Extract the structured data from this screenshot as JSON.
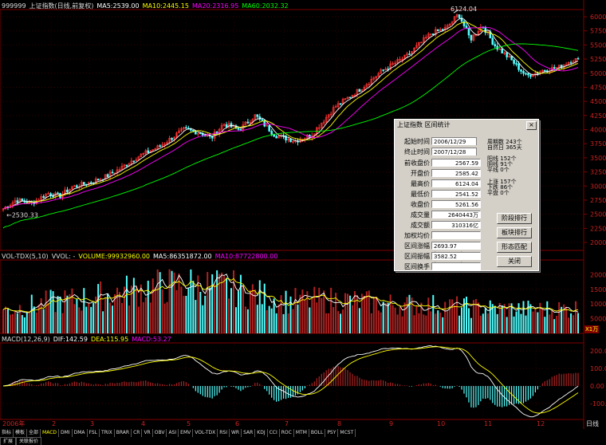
{
  "main_header": {
    "code": "999999",
    "name": "上证指数(日线,前复权)",
    "ma5_label": "MA5:",
    "ma5_value": "2539.00",
    "ma10_label": "MA10:",
    "ma10_value": "2445.15",
    "ma20_label": "MA20:",
    "ma20_value": "2316.95",
    "ma60_label": "MA60:",
    "ma60_value": "2032.32"
  },
  "vol_header": {
    "name": "VOL-TDX(5,10)",
    "vvol": "VVOL: -",
    "volume_label": "VOLUME:",
    "volume_value": "99932960.00",
    "ma5_label": "MA5:",
    "ma5_value": "86351872.00",
    "ma10_label": "MA10:",
    "ma10_value": "87722800.00"
  },
  "macd_header": {
    "name": "MACD(12,26,9)",
    "dif_label": "DIF:",
    "dif_value": "142.59",
    "dea_label": "DEA:",
    "dea_value": "115.95",
    "macd_label": "MACD:",
    "macd_value": "53.27"
  },
  "price_axis": [
    "6000",
    "5750",
    "5500",
    "5250",
    "5000",
    "4750",
    "4500",
    "4250",
    "4000",
    "3750",
    "3500",
    "3250",
    "3000",
    "2750",
    "2500",
    "2250",
    "2000"
  ],
  "vol_axis": [
    "20000",
    "15000",
    "10000",
    "5000"
  ],
  "vol_unit": "X1万",
  "macd_axis": [
    "200.0",
    "100.0",
    "0.00",
    "-100.0"
  ],
  "time_axis": [
    "2006年",
    "2",
    "3",
    "4",
    "5",
    "6",
    "7",
    "8",
    "9",
    "10",
    "11",
    "12"
  ],
  "period_label": "日线",
  "annotations": {
    "high": "6124.04",
    "low": "2530.33"
  },
  "colors": {
    "up": "#ff3232",
    "down": "#54ffff",
    "ma5": "#ffffff",
    "ma10": "#ffff00",
    "ma20": "#ff00ff",
    "ma60": "#00ff00"
  },
  "chart_data": [
    {
      "type": "line",
      "title": "上证指数(日线,前复权)",
      "x": [
        "2006年",
        "2",
        "3",
        "4",
        "5",
        "6",
        "7",
        "8",
        "9",
        "10",
        "11",
        "12"
      ],
      "series": [
        {
          "name": "MA5",
          "values": [
            2560,
            2700,
            2850,
            3050,
            3700,
            3950,
            3800,
            4400,
            5000,
            5600,
            5200,
            4950
          ]
        },
        {
          "name": "MA60",
          "values": [
            2150,
            2350,
            2550,
            2700,
            3000,
            3350,
            3600,
            3900,
            4350,
            4850,
            5300,
            5350
          ]
        }
      ],
      "ylim": [
        1900,
        6200
      ]
    },
    {
      "type": "bar",
      "title": "VOL-TDX(5,10)",
      "categories": [
        "2006年",
        "2",
        "3",
        "4",
        "5",
        "6",
        "7",
        "8",
        "9",
        "10",
        "11",
        "12"
      ],
      "values": [
        9500,
        11000,
        12500,
        16000,
        17000,
        16500,
        11500,
        12000,
        10500,
        10000,
        9000,
        9000
      ],
      "ylim": [
        0,
        22000
      ]
    },
    {
      "type": "line",
      "title": "MACD(12,26,9)",
      "x": [
        "2006年",
        "2",
        "3",
        "4",
        "5",
        "6",
        "7",
        "8",
        "9",
        "10",
        "11",
        "12"
      ],
      "series": [
        {
          "name": "DIF",
          "values": [
            60,
            30,
            150,
            80,
            70,
            60,
            -100,
            80,
            170,
            200,
            30,
            -180
          ]
        },
        {
          "name": "DEA",
          "values": [
            50,
            45,
            120,
            100,
            80,
            70,
            -50,
            40,
            150,
            190,
            80,
            -120
          ]
        }
      ],
      "ylim": [
        -180,
        230
      ]
    }
  ],
  "dialog": {
    "title": "上证指数 区间统计",
    "close": "×",
    "start_time_label": "起始时间",
    "start_time_value": "2006/12/29",
    "end_time_label": "终止时间",
    "end_time_value": "2007/12/28",
    "prev_close_label": "前收盘价",
    "prev_close_value": "2567.59",
    "open_label": "开盘价",
    "open_value": "2585.42",
    "high_label": "最高价",
    "high_value": "6124.04",
    "low_label": "最低价",
    "low_value": "2541.52",
    "close_label": "收盘价",
    "close_value": "5261.56",
    "volume_label": "成交量",
    "volume_value": "2640443万",
    "amount_label": "成交额",
    "amount_value": "310316亿",
    "wavg_label": "加权均价",
    "wavg_value": "",
    "change_label": "区间涨幅",
    "change_value": "2693.97 (104.92%)",
    "amp_label": "区间振幅",
    "amp_value": "3582.52 (140.96%)",
    "turnover_label": "区间换手",
    "turnover_value": "",
    "stats": {
      "period_days_label": "周期数",
      "period_days_value": "243个",
      "natural_days_label": "自然日",
      "natural_days_value": "365天",
      "up_k_label": "阳线",
      "up_k_value": "152个",
      "down_k_label": "阴线",
      "down_k_value": "91个",
      "flat_k_label": "平线",
      "flat_k_value": "0个",
      "up_label": "上涨",
      "up_value": "157个",
      "down_label": "下跌",
      "down_value": "86个",
      "flat_label": "平盘",
      "flat_value": "0个"
    },
    "btn_sort": "阶段排行",
    "btn_sector": "板块排行",
    "btn_pattern": "形态匹配",
    "btn_close": "关闭"
  },
  "tabs": [
    "指标",
    "模板",
    "全部",
    "MACD",
    "DMI",
    "DMA",
    "FSL",
    "TRIX",
    "BRAR",
    "CR",
    "VR",
    "OBV",
    "ASI",
    "EMV",
    "VOL-TDX",
    "RSI",
    "WR",
    "SAR",
    "KDJ",
    "CCI",
    "ROC",
    "MTM",
    "BOLL",
    "PSY",
    "MCST"
  ],
  "bottom_tabs": [
    "扩展",
    "关联报价"
  ]
}
